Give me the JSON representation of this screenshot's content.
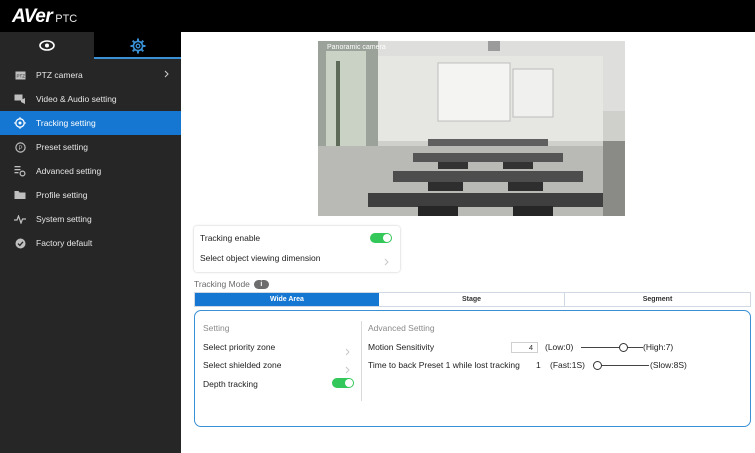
{
  "brand": {
    "logo": "AVer",
    "sub": "PTC"
  },
  "sidebar": {
    "items": [
      {
        "label": "PTZ camera",
        "icon": "ptz-camera-icon"
      },
      {
        "label": "Video & Audio setting",
        "icon": "video-audio-icon"
      },
      {
        "label": "Tracking setting",
        "icon": "tracking-icon"
      },
      {
        "label": "Preset setting",
        "icon": "preset-icon"
      },
      {
        "label": "Advanced setting",
        "icon": "advanced-icon"
      },
      {
        "label": "Profile setting",
        "icon": "folder-icon"
      },
      {
        "label": "System setting",
        "icon": "pulse-icon"
      },
      {
        "label": "Factory default",
        "icon": "check-circle-icon"
      }
    ]
  },
  "camera": {
    "title": "Panoramic camera"
  },
  "tracking": {
    "enable_label": "Tracking enable",
    "enabled": true,
    "dimension_label": "Select object viewing dimension"
  },
  "mode": {
    "label": "Tracking Mode",
    "tabs": [
      "Wide Area",
      "Stage",
      "Segment"
    ],
    "selected": "Wide Area"
  },
  "setting": {
    "title": "Setting",
    "priority_zone": "Select priority zone",
    "shielded_zone": "Select shielded zone",
    "depth_tracking": "Depth tracking",
    "depth_enabled": true
  },
  "advanced": {
    "title": "Advanced Setting",
    "sensitivity": {
      "label": "Motion Sensitivity",
      "value": "4",
      "low": "(Low:0)",
      "high": "(High:7)",
      "level": 0.57
    },
    "back_preset": {
      "label": "Time to back Preset 1 while lost tracking",
      "value": "1",
      "low": "(Fast:1S)",
      "high": "(Slow:8S)",
      "level": 0.0
    }
  },
  "colors": {
    "accent": "#1677d2",
    "toggle_on": "#34c759",
    "sidebar_bg": "#262626"
  }
}
